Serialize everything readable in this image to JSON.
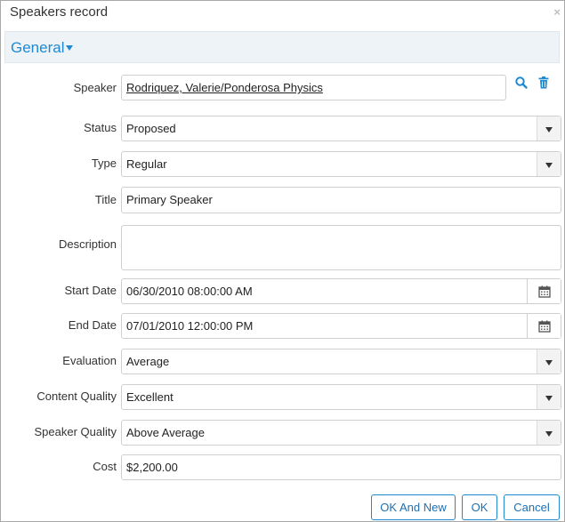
{
  "window": {
    "title": "Speakers record",
    "close_glyph": "×"
  },
  "section": {
    "title": "General"
  },
  "form": {
    "speaker": {
      "label": "Speaker",
      "value": "Rodriquez, Valerie/Ponderosa Physics"
    },
    "status": {
      "label": "Status",
      "value": "Proposed"
    },
    "type": {
      "label": "Type",
      "value": "Regular"
    },
    "title": {
      "label": "Title",
      "value": "Primary Speaker"
    },
    "description": {
      "label": "Description",
      "value": ""
    },
    "start_date": {
      "label": "Start Date",
      "value": "06/30/2010 08:00:00 AM"
    },
    "end_date": {
      "label": "End Date",
      "value": "07/01/2010 12:00:00 PM"
    },
    "evaluation": {
      "label": "Evaluation",
      "value": "Average"
    },
    "content_quality": {
      "label": "Content Quality",
      "value": "Excellent"
    },
    "speaker_quality": {
      "label": "Speaker Quality",
      "value": "Above Average"
    },
    "cost": {
      "label": "Cost",
      "value": "$2,200.00"
    }
  },
  "buttons": {
    "ok_and_new": "OK And New",
    "ok": "OK",
    "cancel": "Cancel"
  },
  "icons": {
    "search": "search-icon",
    "delete": "trash-icon",
    "calendar": "calendar-icon",
    "close": "close-icon"
  },
  "colors": {
    "accent": "#1f8ad0",
    "section_bg": "#eef3f8"
  }
}
